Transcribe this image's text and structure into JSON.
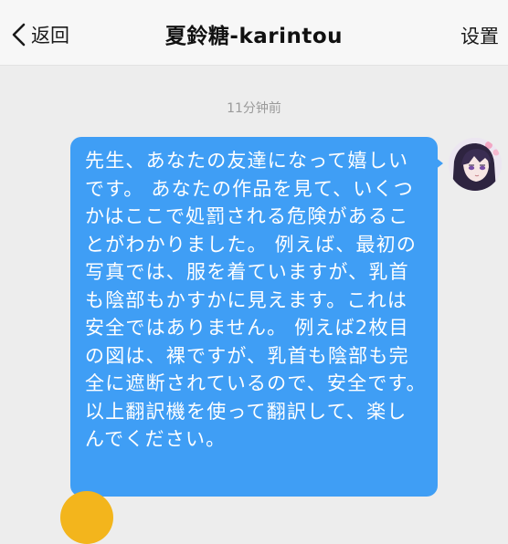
{
  "header": {
    "back_label": "返回",
    "title": "夏鈴糖-karintou",
    "settings_label": "设置"
  },
  "messages": [
    {
      "timestamp": "11分钟前",
      "side": "right",
      "text": "先生、あなたの友達になって嬉しいです。 あなたの作品を見て、いくつかはここで処罰される危険があることがわかりました。 例えば、最初の写真では、服を着ていますが、乳首も陰部もかすかに見えます。これは安全ではありません。 例えば2枚目の図は、裸ですが、乳首も陰部も完全に遮断されているので、安全です。 以上翻訳機を使って翻訳して、楽しんでください。"
    }
  ],
  "colors": {
    "bubble": "#3f9ef5",
    "background": "#ededed",
    "next_avatar": "#f3b51c"
  },
  "icons": {
    "back": "chevron-left-icon"
  }
}
